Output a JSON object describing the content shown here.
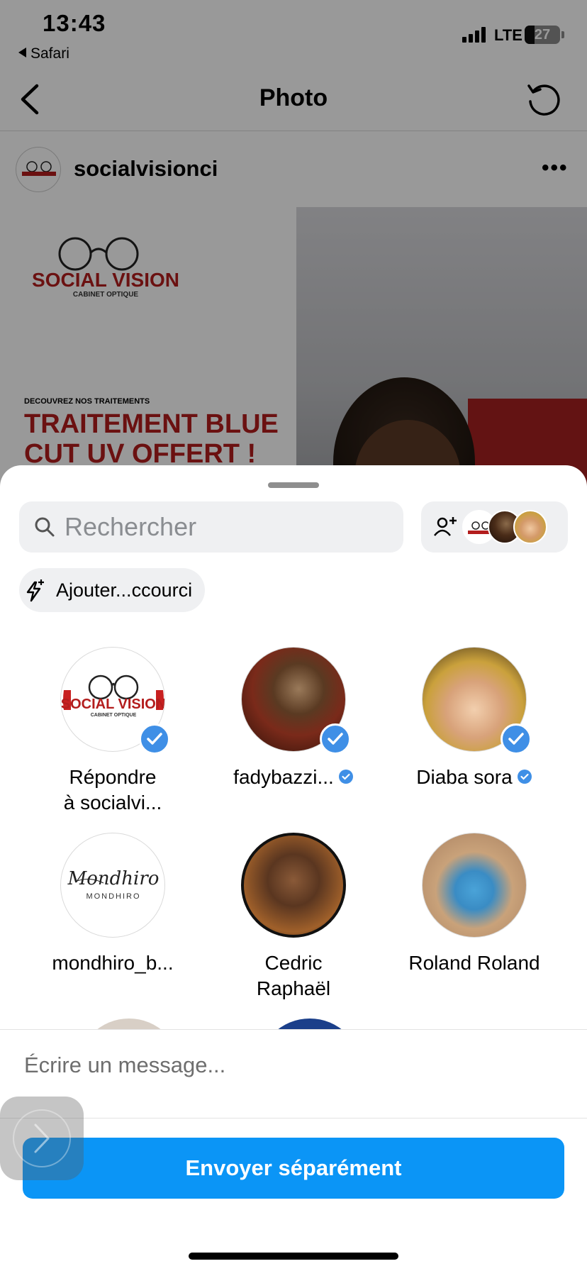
{
  "status_bar": {
    "time": "13:43",
    "back_app": "Safari",
    "network": "LTE",
    "battery": "27"
  },
  "nav": {
    "title": "Photo"
  },
  "post": {
    "username": "socialvisionci",
    "brand_name": "SOCIAL VISION",
    "brand_sub": "CABINET OPTIQUE",
    "discover": "DECOUVREZ NOS TRAITEMENTS",
    "promo_line1": "TRAITEMENT BLUE",
    "promo_line2": "CUT UV OFFERT !"
  },
  "share_sheet": {
    "search_placeholder": "Rechercher",
    "shortcut_label": "Ajouter...ccourci",
    "contacts": [
      {
        "label_line1": "Répondre",
        "label_line2": "à socialvi...",
        "selected": true,
        "verified": false,
        "avatar": "social-vision-logo"
      },
      {
        "label_line1": "fadybazzi...",
        "label_line2": "",
        "selected": true,
        "verified": true,
        "avatar": "photo-man-car"
      },
      {
        "label_line1": "Diaba sora",
        "label_line2": "",
        "selected": true,
        "verified": true,
        "avatar": "photo-woman-gold-hat"
      },
      {
        "label_line1": "mondhiro_b...",
        "label_line2": "",
        "selected": false,
        "verified": false,
        "avatar": "mondhiro-logo",
        "logo_script": "Mondhiro",
        "logo_caps": "MONDHIRO"
      },
      {
        "label_line1": "Cedric",
        "label_line2": "Raphaël",
        "selected": false,
        "verified": false,
        "avatar": "photo-man-suit"
      },
      {
        "label_line1": "Roland Roland",
        "label_line2": "",
        "selected": false,
        "verified": false,
        "avatar": "photo-boy-blue-shirt"
      }
    ],
    "message_placeholder": "Écrire un message...",
    "send_button": "Envoyer séparément"
  },
  "colors": {
    "accent": "#0b95f6",
    "check": "#3f8fe6",
    "brand_red": "#b31d1d",
    "sheet_bg": "#ffffff",
    "field_bg": "#eff0f2"
  }
}
